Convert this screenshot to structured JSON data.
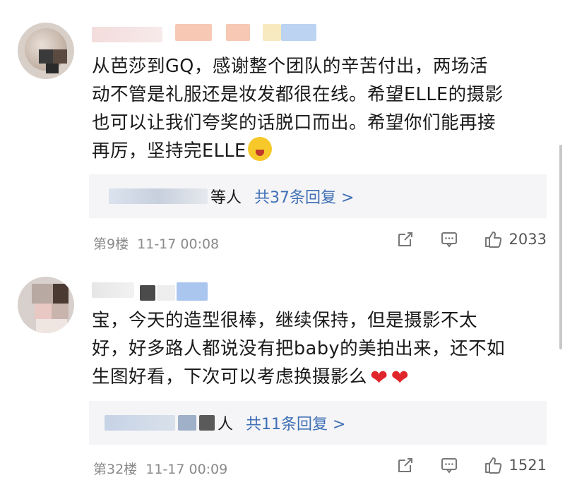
{
  "comments": [
    {
      "text_lines": [
        "从芭莎到GQ，感谢整个团队的辛苦付出，两场活",
        "动不管是礼服还是妆发都很在线。希望ELLE的摄影",
        "也可以让我们夸奖的话脱口而出。希望你们能再接",
        "再厉，坚持完ELLE"
      ],
      "emoji": "sweat-grin-emoji",
      "reply_who_suffix": "等人",
      "reply_link": "共37条回复 >",
      "floor": "第9楼",
      "time": "11-17 00:08",
      "likes": "2033"
    },
    {
      "text_lines": [
        "宝，今天的造型很棒，继续保持，但是摄影不太",
        "好，好多路人都说没有把baby的美拍出来，还不如",
        "生图好看，下次可以考虑换摄影么"
      ],
      "emoji": "heart-emoji",
      "reply_who_suffix": "人",
      "reply_link": "共11条回复 >",
      "floor": "第32楼",
      "time": "11-17 00:09",
      "likes": "1521"
    }
  ],
  "colors": {
    "link": "#3f6fb5",
    "meta": "#8a8a8a",
    "heart": "#e0262a",
    "reply_bg": "#f5f5f7"
  }
}
